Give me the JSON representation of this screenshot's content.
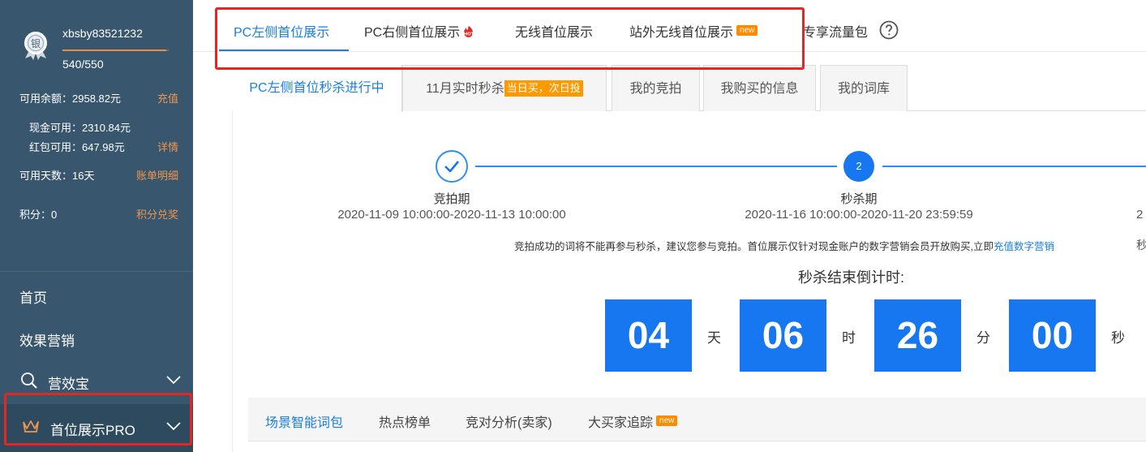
{
  "sidebar": {
    "username": "xbsby83521232",
    "score_text": "540/550",
    "score_progress": 0.98,
    "medal_char": "银",
    "balance_label": "可用余额：2958.82元",
    "recharge_link": "充值",
    "cash_label": "现金可用：2310.84元",
    "redpacket_label": "红包可用：647.98元",
    "details_link": "详情",
    "days_label": "可用天数：16天",
    "bill_link": "账单明细",
    "points_label": "积分：0",
    "points_link": "积分兑奖",
    "nav": [
      {
        "label": "首页"
      },
      {
        "label": "效果营销"
      },
      {
        "label": "营效宝",
        "icon": "search-icon"
      },
      {
        "label": "首位展示PRO",
        "icon": "crown-icon"
      }
    ]
  },
  "top_tabs": [
    {
      "label": "PC左侧首位展示",
      "active": true
    },
    {
      "label": "PC右侧首位展示",
      "badge": "HOT"
    },
    {
      "label": "无线首位展示"
    },
    {
      "label": "站外无线首位展示",
      "badge": "new"
    },
    {
      "label": "专享流量包"
    }
  ],
  "sub_tabs": [
    {
      "label": "PC左侧首位秒杀进行中",
      "active": true
    },
    {
      "label": "11月实时秒杀",
      "tag": "当日买，次日投"
    },
    {
      "label": "我的竞拍"
    },
    {
      "label": "我购买的信息"
    },
    {
      "label": "我的词库"
    }
  ],
  "steps": [
    {
      "title": "竞拍期",
      "dates": "2020-11-09 10:00:00-2020-11-13 10:00:00",
      "status": "done"
    },
    {
      "title": "秒杀期",
      "dates": "2020-11-16 10:00:00-2020-11-20 23:59:59",
      "number": "2",
      "status": "current"
    }
  ],
  "edge_fragments": {
    "step3_dates": "2",
    "notice_tail": "秒"
  },
  "notice": {
    "text": "竞拍成功的词将不能再参与秒杀，建议您参与竞拍。首位展示仅针对现金账户的数字营销会员开放购买,立即",
    "link": "充值数字营销"
  },
  "countdown": {
    "title": "秒杀结束倒计时:",
    "days": "04",
    "days_unit": "天",
    "hours": "06",
    "hours_unit": "时",
    "minutes": "26",
    "minutes_unit": "分",
    "seconds": "00",
    "seconds_unit": "秒"
  },
  "bottom_tabs": [
    {
      "label": "场景智能词包",
      "active": true
    },
    {
      "label": "热点榜单"
    },
    {
      "label": "竞对分析(卖家)"
    },
    {
      "label": "大买家追踪",
      "badge": "new"
    }
  ],
  "colors": {
    "sidebar_bg": "#38576e",
    "accent": "#1a7fe0",
    "countdown_bg": "#1677f0",
    "link_orange": "#f0954f",
    "highlight_red": "#e8251f"
  }
}
